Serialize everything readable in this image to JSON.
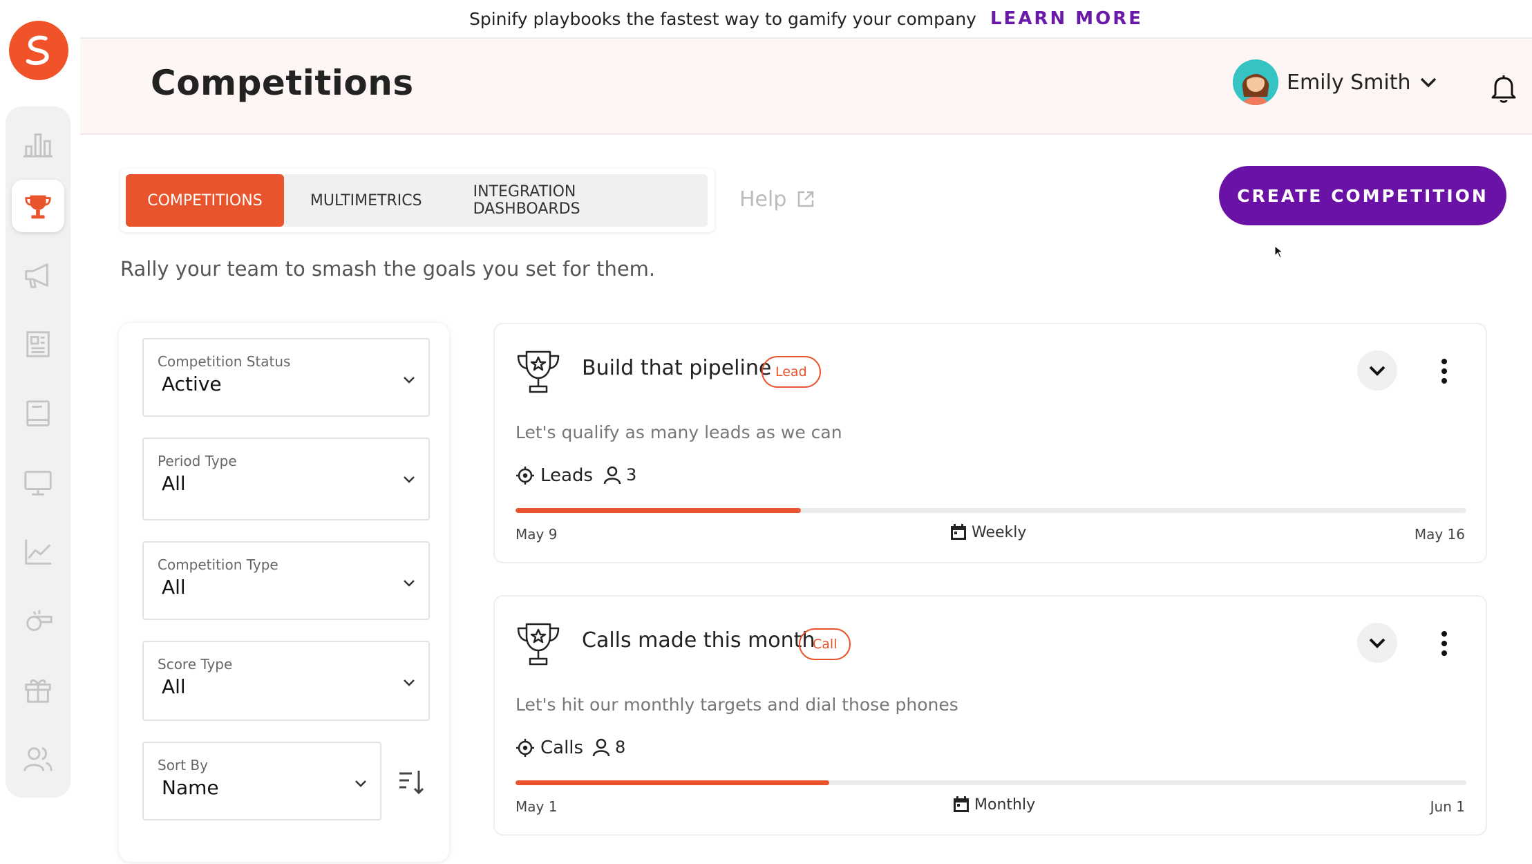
{
  "banner": {
    "text": "Spinify playbooks the fastest way to gamify your company",
    "link": "LEARN MORE"
  },
  "header": {
    "title": "Competitions",
    "user_name": "Emily Smith"
  },
  "tabs": [
    {
      "label": "COMPETITIONS",
      "active": true
    },
    {
      "label": "MULTIMETRICS",
      "active": false
    },
    {
      "label": "INTEGRATION DASHBOARDS",
      "active": false
    }
  ],
  "help_label": "Help",
  "create_button": "CREATE COMPETITION",
  "subtitle": "Rally your team to smash the goals you set for them.",
  "filters": {
    "status": {
      "label": "Competition Status",
      "value": "Active"
    },
    "period": {
      "label": "Period Type",
      "value": "All"
    },
    "type": {
      "label": "Competition Type",
      "value": "All"
    },
    "score": {
      "label": "Score Type",
      "value": "All"
    },
    "sort": {
      "label": "Sort By",
      "value": "Name"
    }
  },
  "competitions": [
    {
      "title": "Build that pipeline",
      "badge": "Lead",
      "description": "Let's qualify as many leads as we can",
      "metric": "Leads",
      "participants": "3",
      "progress": 0.3,
      "start": "May 9",
      "period": "Weekly",
      "end": "May 16"
    },
    {
      "title": "Calls made this month",
      "badge": "Call",
      "description": "Let's hit our monthly targets and dial those phones",
      "metric": "Calls",
      "participants": "8",
      "progress": 0.33,
      "start": "May 1",
      "period": "Monthly",
      "end": "Jun 1"
    }
  ],
  "colors": {
    "brand_orange": "#e8542b",
    "brand_purple": "#6a12a6",
    "learn_more": "#6a1aa8"
  }
}
